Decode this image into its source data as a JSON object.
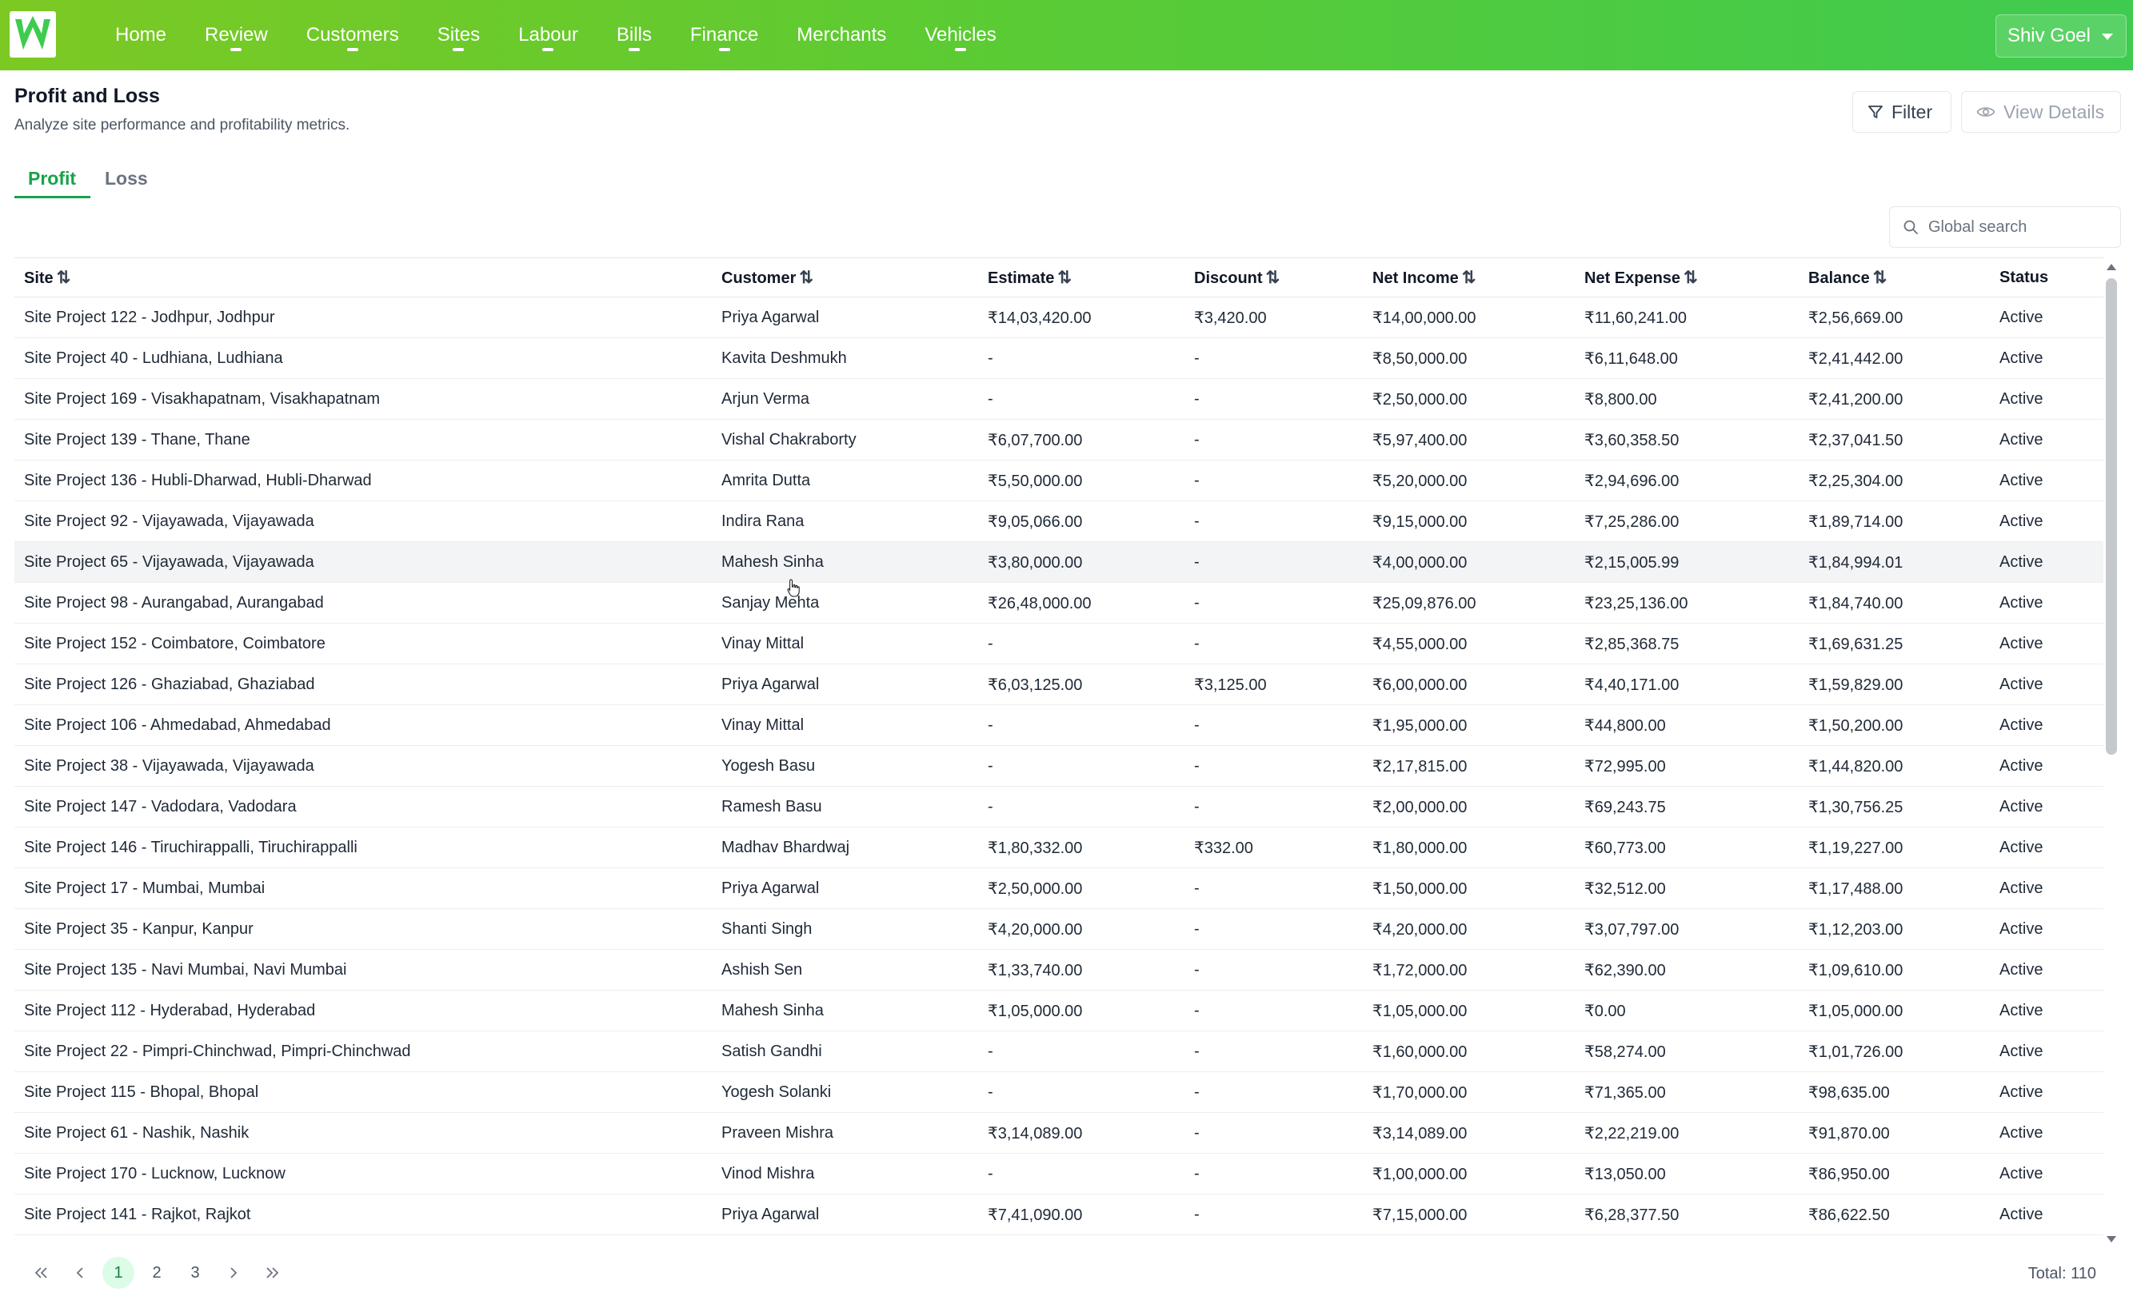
{
  "nav": {
    "logo_letter": "W",
    "items": [
      {
        "label": "Home",
        "dropdown": false
      },
      {
        "label": "Review",
        "dropdown": true
      },
      {
        "label": "Customers",
        "dropdown": true
      },
      {
        "label": "Sites",
        "dropdown": true
      },
      {
        "label": "Labour",
        "dropdown": true
      },
      {
        "label": "Bills",
        "dropdown": true
      },
      {
        "label": "Finance",
        "dropdown": true
      },
      {
        "label": "Merchants",
        "dropdown": false
      },
      {
        "label": "Vehicles",
        "dropdown": true
      }
    ],
    "user": "Shiv Goel"
  },
  "page": {
    "title": "Profit and Loss",
    "subtitle": "Analyze site performance and profitability metrics.",
    "filter_label": "Filter",
    "view_details_label": "View Details"
  },
  "tabs": [
    {
      "label": "Profit",
      "active": true
    },
    {
      "label": "Loss",
      "active": false
    }
  ],
  "search": {
    "placeholder": "Global search"
  },
  "table": {
    "columns": [
      "Site",
      "Customer",
      "Estimate",
      "Discount",
      "Net Income",
      "Net Expense",
      "Balance",
      "Status"
    ],
    "rows": [
      [
        "Site Project 122 - Jodhpur, Jodhpur",
        "Priya Agarwal",
        "₹14,03,420.00",
        "₹3,420.00",
        "₹14,00,000.00",
        "₹11,60,241.00",
        "₹2,56,669.00",
        "Active"
      ],
      [
        "Site Project 40 - Ludhiana, Ludhiana",
        "Kavita Deshmukh",
        "-",
        "-",
        "₹8,50,000.00",
        "₹6,11,648.00",
        "₹2,41,442.00",
        "Active"
      ],
      [
        "Site Project 169 - Visakhapatnam, Visakhapatnam",
        "Arjun Verma",
        "-",
        "-",
        "₹2,50,000.00",
        "₹8,800.00",
        "₹2,41,200.00",
        "Active"
      ],
      [
        "Site Project 139 - Thane, Thane",
        "Vishal Chakraborty",
        "₹6,07,700.00",
        "-",
        "₹5,97,400.00",
        "₹3,60,358.50",
        "₹2,37,041.50",
        "Active"
      ],
      [
        "Site Project 136 - Hubli-Dharwad, Hubli-Dharwad",
        "Amrita Dutta",
        "₹5,50,000.00",
        "-",
        "₹5,20,000.00",
        "₹2,94,696.00",
        "₹2,25,304.00",
        "Active"
      ],
      [
        "Site Project 92 - Vijayawada, Vijayawada",
        "Indira Rana",
        "₹9,05,066.00",
        "-",
        "₹9,15,000.00",
        "₹7,25,286.00",
        "₹1,89,714.00",
        "Active"
      ],
      [
        "Site Project 65 - Vijayawada, Vijayawada",
        "Mahesh Sinha",
        "₹3,80,000.00",
        "-",
        "₹4,00,000.00",
        "₹2,15,005.99",
        "₹1,84,994.01",
        "Active"
      ],
      [
        "Site Project 98 - Aurangabad, Aurangabad",
        "Sanjay Mehta",
        "₹26,48,000.00",
        "-",
        "₹25,09,876.00",
        "₹23,25,136.00",
        "₹1,84,740.00",
        "Active"
      ],
      [
        "Site Project 152 - Coimbatore, Coimbatore",
        "Vinay Mittal",
        "-",
        "-",
        "₹4,55,000.00",
        "₹2,85,368.75",
        "₹1,69,631.25",
        "Active"
      ],
      [
        "Site Project 126 - Ghaziabad, Ghaziabad",
        "Priya Agarwal",
        "₹6,03,125.00",
        "₹3,125.00",
        "₹6,00,000.00",
        "₹4,40,171.00",
        "₹1,59,829.00",
        "Active"
      ],
      [
        "Site Project 106 - Ahmedabad, Ahmedabad",
        "Vinay Mittal",
        "-",
        "-",
        "₹1,95,000.00",
        "₹44,800.00",
        "₹1,50,200.00",
        "Active"
      ],
      [
        "Site Project 38 - Vijayawada, Vijayawada",
        "Yogesh Basu",
        "-",
        "-",
        "₹2,17,815.00",
        "₹72,995.00",
        "₹1,44,820.00",
        "Active"
      ],
      [
        "Site Project 147 - Vadodara, Vadodara",
        "Ramesh Basu",
        "-",
        "-",
        "₹2,00,000.00",
        "₹69,243.75",
        "₹1,30,756.25",
        "Active"
      ],
      [
        "Site Project 146 - Tiruchirappalli, Tiruchirappalli",
        "Madhav Bhardwaj",
        "₹1,80,332.00",
        "₹332.00",
        "₹1,80,000.00",
        "₹60,773.00",
        "₹1,19,227.00",
        "Active"
      ],
      [
        "Site Project 17 - Mumbai, Mumbai",
        "Priya Agarwal",
        "₹2,50,000.00",
        "-",
        "₹1,50,000.00",
        "₹32,512.00",
        "₹1,17,488.00",
        "Active"
      ],
      [
        "Site Project 35 - Kanpur, Kanpur",
        "Shanti Singh",
        "₹4,20,000.00",
        "-",
        "₹4,20,000.00",
        "₹3,07,797.00",
        "₹1,12,203.00",
        "Active"
      ],
      [
        "Site Project 135 - Navi Mumbai, Navi Mumbai",
        "Ashish Sen",
        "₹1,33,740.00",
        "-",
        "₹1,72,000.00",
        "₹62,390.00",
        "₹1,09,610.00",
        "Active"
      ],
      [
        "Site Project 112 - Hyderabad, Hyderabad",
        "Mahesh Sinha",
        "₹1,05,000.00",
        "-",
        "₹1,05,000.00",
        "₹0.00",
        "₹1,05,000.00",
        "Active"
      ],
      [
        "Site Project 22 - Pimpri-Chinchwad, Pimpri-Chinchwad",
        "Satish Gandhi",
        "-",
        "-",
        "₹1,60,000.00",
        "₹58,274.00",
        "₹1,01,726.00",
        "Active"
      ],
      [
        "Site Project 115 - Bhopal, Bhopal",
        "Yogesh Solanki",
        "-",
        "-",
        "₹1,70,000.00",
        "₹71,365.00",
        "₹98,635.00",
        "Active"
      ],
      [
        "Site Project 61 - Nashik, Nashik",
        "Praveen Mishra",
        "₹3,14,089.00",
        "-",
        "₹3,14,089.00",
        "₹2,22,219.00",
        "₹91,870.00",
        "Active"
      ],
      [
        "Site Project 170 - Lucknow, Lucknow",
        "Vinod Mishra",
        "-",
        "-",
        "₹1,00,000.00",
        "₹13,050.00",
        "₹86,950.00",
        "Active"
      ],
      [
        "Site Project 141 - Rajkot, Rajkot",
        "Priya Agarwal",
        "₹7,41,090.00",
        "-",
        "₹7,15,000.00",
        "₹6,28,377.50",
        "₹86,622.50",
        "Active"
      ]
    ],
    "highlighted_row": 6
  },
  "pagination": {
    "pages": [
      "1",
      "2",
      "3"
    ],
    "current": "1",
    "total": "Total: 110"
  },
  "colors": {
    "brand_green": "#4cc93f",
    "accent": "#16a34a"
  }
}
